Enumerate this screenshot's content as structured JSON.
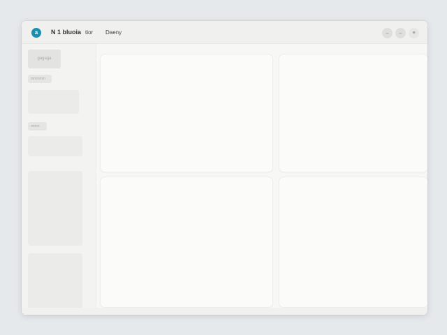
{
  "titlebar": {
    "logo_glyph": "a",
    "app_title": "N 1 bluoia",
    "menu": [
      "tior",
      "Daeny"
    ],
    "controls": [
      "–",
      "–",
      "≡"
    ]
  },
  "sidebar": {
    "button_label": "gagaga",
    "chip_labels": [
      "mmmmm",
      "mmm"
    ]
  },
  "colors": {
    "accent": "#1a8fb0",
    "background": "#e6e9ec",
    "window": "#f7f7f6"
  },
  "icons": [
    "app-logo-icon",
    "minimize-icon",
    "maximize-icon",
    "menu-icon"
  ]
}
